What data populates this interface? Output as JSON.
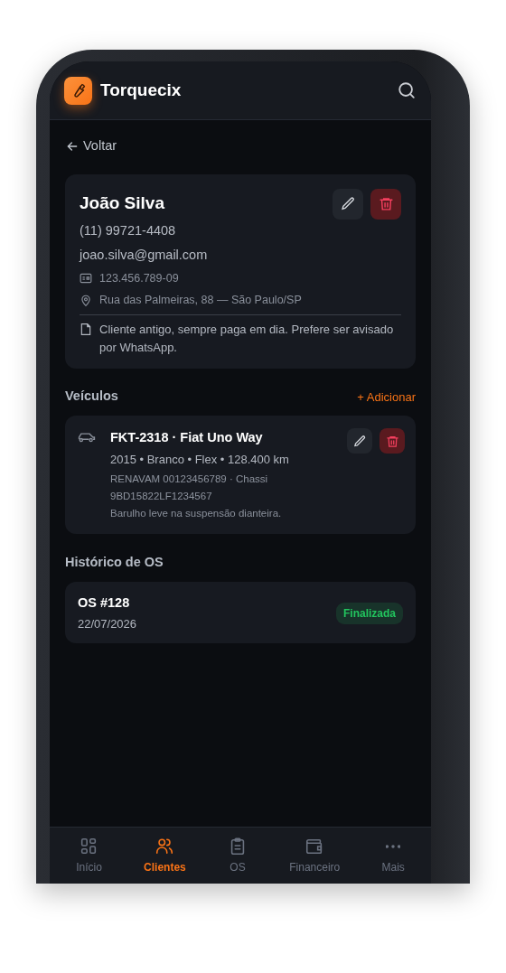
{
  "app": {
    "name": "Torquecix"
  },
  "back": {
    "label": "Voltar"
  },
  "client": {
    "name": "João Silva",
    "phone": "(11) 99721-4408",
    "email": "joao.silva@gmail.com",
    "document": "123.456.789-09",
    "address": "Rua das Palmeiras, 88 — São Paulo/SP",
    "note": "Cliente antigo, sempre paga em dia. Prefere ser avisado por WhatsApp."
  },
  "vehicles": {
    "title": "Veículos",
    "add_label": "+ Adicionar",
    "items": [
      {
        "title": "FKT-2318 · Fiat Uno Way",
        "details": "2015 • Branco • Flex • 128.400 km",
        "registry": "RENAVAM 00123456789 · Chassi 9BD15822LF1234567",
        "note": "Barulho leve na suspensão dianteira."
      }
    ]
  },
  "history": {
    "title": "Histórico de OS",
    "items": [
      {
        "number": "OS #128",
        "date": "22/07/2026",
        "status": "Finalizada",
        "color": "#22c55e"
      }
    ]
  },
  "bottom_nav": [
    {
      "label": "Início",
      "kind": "grid",
      "selected": false
    },
    {
      "label": "Clientes",
      "kind": "users",
      "selected": true
    },
    {
      "label": "OS",
      "kind": "clipboard",
      "selected": false
    },
    {
      "label": "Financeiro",
      "kind": "wallet",
      "selected": false
    },
    {
      "label": "Mais",
      "kind": "more",
      "selected": false
    }
  ]
}
